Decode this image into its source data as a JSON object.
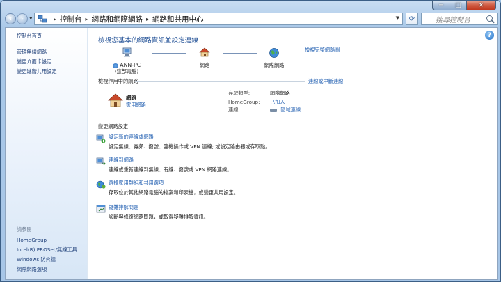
{
  "window": {
    "controls": {
      "minimize": "─",
      "maximize": "□",
      "close": "✕"
    }
  },
  "nav": {
    "breadcrumb": [
      "控制台",
      "網路和網際網路",
      "網路和共用中心"
    ],
    "search_placeholder": "搜尋控制台"
  },
  "sidebar": {
    "items": [
      {
        "label": "控制台首頁"
      },
      {
        "label": "管理無線網路"
      },
      {
        "label": "變更介面卡設定"
      },
      {
        "label": "變更進階共用設定"
      }
    ],
    "see_also_title": "請參閱",
    "see_also": [
      {
        "label": "HomeGroup"
      },
      {
        "label": "Intel(R) PROSet/無線工具"
      },
      {
        "label": "Windows 防火牆"
      },
      {
        "label": "網際網路選項"
      }
    ]
  },
  "main": {
    "title": "檢視您基本的網路資訊並設定連線",
    "full_map_link": "檢視完整網路圖",
    "map": {
      "computer_name": "ANN-PC",
      "computer_sub": "(這部電腦)",
      "network": "網路",
      "internet": "網際網路"
    },
    "active_header": "檢視作用中的網路",
    "connect_disconnect": "連線或中斷連線",
    "network": {
      "name": "網路",
      "type": "家用網路",
      "access_type_label": "存取類型:",
      "access_type_value": "網際網路",
      "homegroup_label": "HomeGroup:",
      "homegroup_value": "已加入",
      "connections_label": "連線:",
      "connections_value": "區域連線"
    },
    "change_header": "變更網路設定",
    "tasks": [
      {
        "title": "設定新的連線或網路",
        "desc": "設定無線、寬頻、撥號、臨機操作或 VPN 連線; 或設定路由器或存取點。"
      },
      {
        "title": "連線到網路",
        "desc": "連線或重新連線到無線、有線、撥號或 VPN 網路連線。"
      },
      {
        "title": "選擇家用群組和共用選項",
        "desc": "存取位於其他網路電腦的檔案和印表機，或變更共用設定。"
      },
      {
        "title": "疑難排解問題",
        "desc": "診斷與修復網路問題，或取得疑難排解資訊。"
      }
    ]
  }
}
